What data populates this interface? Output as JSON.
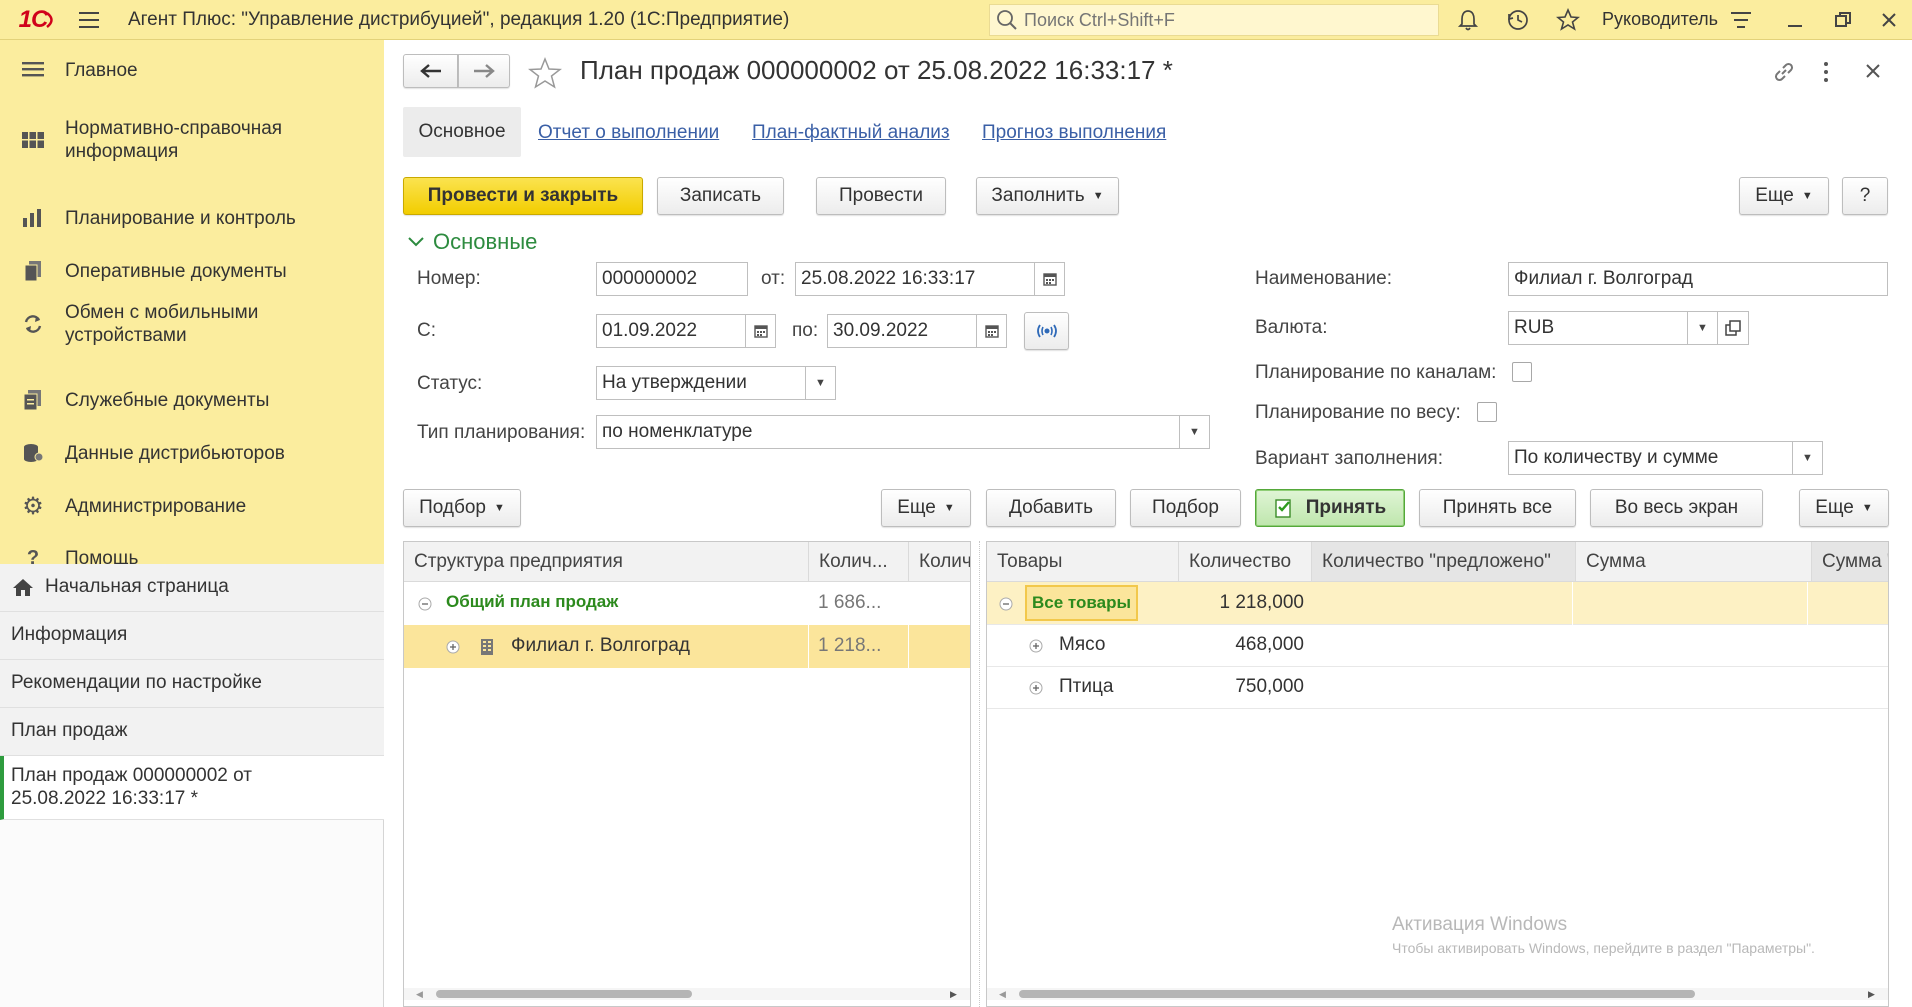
{
  "titlebar": {
    "logo": "1С",
    "app_title": "Агент Плюс: \"Управление дистрибуцией\", редакция 1.20  (1С:Предприятие)",
    "search_placeholder": "Поиск Ctrl+Shift+F",
    "user": "Руководитель"
  },
  "sidebar": {
    "sections": [
      {
        "label": "Главное",
        "icon": "menu-lines-icon"
      },
      {
        "label": "Нормативно-справочная информация",
        "icon": "catalog-icon"
      },
      {
        "label": "Планирование и контроль",
        "icon": "bar-chart-icon"
      },
      {
        "label": "Оперативные документы",
        "icon": "documents-icon"
      },
      {
        "label": "Обмен с мобильными устройствами",
        "icon": "sync-icon"
      },
      {
        "label": "Служебные документы",
        "icon": "service-docs-icon"
      },
      {
        "label": "Данные дистрибьюторов",
        "icon": "database-icon"
      },
      {
        "label": "Администрирование",
        "icon": "gear-icon"
      },
      {
        "label": "Помощь",
        "icon": "question-icon"
      }
    ],
    "open_windows": [
      {
        "label": "Начальная страница"
      },
      {
        "label": "Информация"
      },
      {
        "label": "Рекомендации по настройке"
      },
      {
        "label": "План продаж"
      },
      {
        "label": "План продаж 000000002 от 25.08.2022 16:33:17 *"
      }
    ]
  },
  "form": {
    "title": "План продаж 000000002 от 25.08.2022 16:33:17 *",
    "tabs": [
      {
        "label": "Основное",
        "active": true
      },
      {
        "label": "Отчет о выполнении"
      },
      {
        "label": "План-фактный анализ"
      },
      {
        "label": "Прогноз выполнения"
      }
    ],
    "buttons": {
      "post_close": "Провести и закрыть",
      "save": "Записать",
      "post": "Провести",
      "fill": "Заполнить",
      "more": "Еще",
      "help": "?"
    },
    "group_title": "Основные",
    "fields": {
      "number_label": "Номер:",
      "number_value": "000000002",
      "date_label": "от:",
      "date_value": "25.08.2022 16:33:17",
      "from_label": "С:",
      "from_value": "01.09.2022",
      "to_label": "по:",
      "to_value": "30.09.2022",
      "status_label": "Статус:",
      "status_value": "На утверждении",
      "plan_type_label": "Тип планирования:",
      "plan_type_value": "по номенклатуре",
      "name_label": "Наименование:",
      "name_value": "Филиал г. Волгоград",
      "currency_label": "Валюта:",
      "currency_value": "RUB",
      "by_channels_label": "Планирование по каналам:",
      "by_weight_label": "Планирование по весу:",
      "fill_variant_label": "Вариант заполнения:",
      "fill_variant_value": "По количеству и сумме"
    },
    "left_panel": {
      "select_btn": "Подбор",
      "more_btn": "Еще",
      "headers": [
        "Структура предприятия",
        "Колич...",
        "Колич"
      ],
      "rows": [
        {
          "name": "Общий план продаж",
          "qty": "1 686..."
        },
        {
          "name": "Филиал г. Волгоград",
          "qty": "1 218..."
        }
      ]
    },
    "right_panel": {
      "add_btn": "Добавить",
      "select_btn": "Подбор",
      "accept_btn": "Принять",
      "accept_all_btn": "Принять все",
      "fullscreen_btn": "Во весь экран",
      "more_btn": "Еще",
      "headers": [
        "Товары",
        "Количество",
        "Количество \"предложено\"",
        "Сумма",
        "Сумма \""
      ],
      "rows": [
        {
          "name": "Все товары",
          "qty": "1 218,000"
        },
        {
          "name": "Мясо",
          "qty": "468,000"
        },
        {
          "name": "Птица",
          "qty": "750,000"
        }
      ]
    },
    "watermark": {
      "title": "Активация Windows",
      "text": "Чтобы активировать Windows, перейдите в раздел \"Параметры\"."
    }
  }
}
